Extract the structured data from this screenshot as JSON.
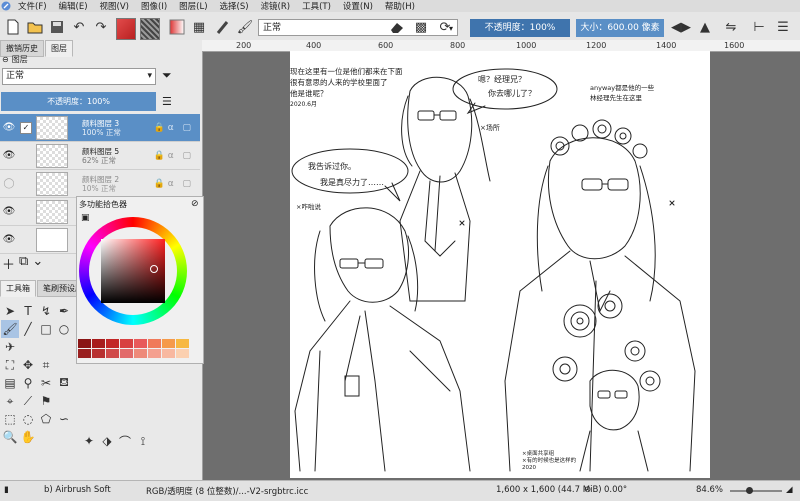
{
  "menu": [
    "文件(F)",
    "编辑(E)",
    "视图(V)",
    "图像(I)",
    "图层(L)",
    "选择(S)",
    "滤镜(R)",
    "工具(T)",
    "设置(N)",
    "帮助(H)"
  ],
  "toolbar": {
    "blend_mode": "正常",
    "opacity_label": "不透明度：100%",
    "opacity_value": 1.0,
    "size_label": "大小：600.00 像素"
  },
  "dock": {
    "tabs": [
      "撤销历史",
      "图层"
    ],
    "layers_title": "图层",
    "blend_mode": "正常",
    "opacity_label": "不透明度：100%",
    "layers": [
      {
        "name": "颜料图层 3",
        "opacity": "100% 正常",
        "visible": true,
        "selected": true
      },
      {
        "name": "颜料图层 5",
        "opacity": "62% 正常",
        "visible": true,
        "selected": false
      },
      {
        "name": "颜料图层 2",
        "opacity": "10% 正常",
        "visible": false,
        "selected": false
      },
      {
        "name": "",
        "opacity": "",
        "visible": true,
        "selected": false
      },
      {
        "name": "",
        "opacity": "",
        "visible": true,
        "selected": false
      }
    ],
    "toolbox_tabs": [
      "工具箱",
      "笔刷预设历"
    ]
  },
  "color_selector": {
    "title": "多功能拾色器",
    "swatches": [
      "#8a1515",
      "#a81c1c",
      "#c22626",
      "#d84040",
      "#e85a5a",
      "#f07a5a",
      "#f59a4a",
      "#f7b840",
      "#9a2020",
      "#b83030",
      "#d04a4a",
      "#e26a6a",
      "#ee8a7a",
      "#f4a090",
      "#f8b8a0",
      "#fbd0b0"
    ]
  },
  "rulers": {
    "h": [
      "200",
      "400",
      "600",
      "800",
      "1000",
      "1200",
      "1400",
      "1600"
    ],
    "v": [
      "1200",
      "1400"
    ]
  },
  "sketch": {
    "top_left_note": [
      "现在这里有一位是他们都来在下面",
      "很有意思的人来的学校里面了",
      "他是谁呢？",
      "2020.6月"
    ],
    "bubble1": [
      "嗯？经理兄？",
      "你去哪儿了？"
    ],
    "small_mark": "×场所",
    "top_right_note": [
      "anyway都是他的一些",
      "林经理先生在这里"
    ],
    "bubble2": [
      "我告诉过你。",
      "我是真尽力了……"
    ],
    "bubble2_note": "×咋啦说",
    "signature": [
      "×桌面共享组",
      "×有的时候也是这样的",
      "2020"
    ]
  },
  "status": {
    "brush": "b) Airbrush Soft",
    "color_profile": "RGB/透明度 (8 位整数)/...-V2-srgbtrc.icc",
    "image_size": "1,600 x 1,600 (44.7 MiB)",
    "rotation": "0.00°",
    "zoom": "84.6%"
  }
}
